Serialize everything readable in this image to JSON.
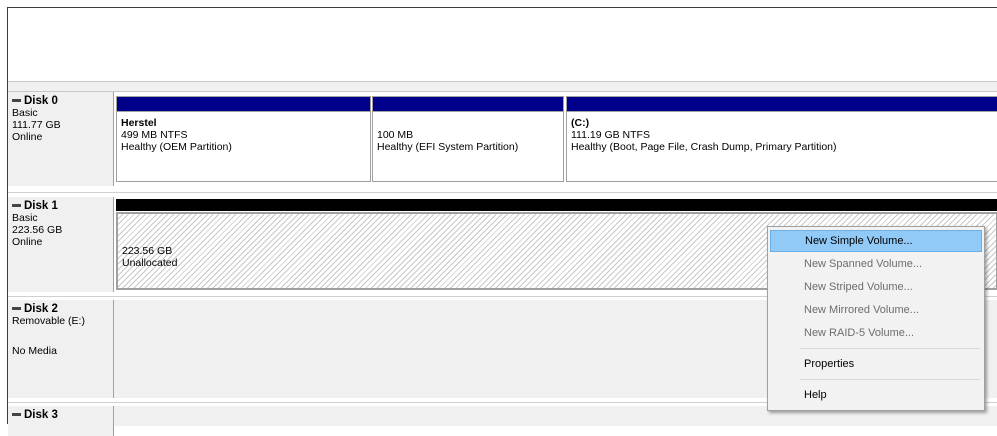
{
  "disks": [
    {
      "name": "Disk 0",
      "type": "Basic",
      "size": "111.77 GB",
      "status": "Online",
      "volumes": [
        {
          "title": "Herstel",
          "detail": "499 MB NTFS",
          "health": "Healthy (OEM Partition)"
        },
        {
          "title": "",
          "detail": "100 MB",
          "health": "Healthy (EFI System Partition)"
        },
        {
          "title": "(C:)",
          "detail": "111.19 GB NTFS",
          "health": "Healthy (Boot, Page File, Crash Dump, Primary Partition)"
        }
      ]
    },
    {
      "name": "Disk 1",
      "type": "Basic",
      "size": "223.56 GB",
      "status": "Online",
      "unallocated": {
        "size": "223.56 GB",
        "label": "Unallocated"
      }
    },
    {
      "name": "Disk 2",
      "type": "Removable (E:)",
      "status": "No Media"
    },
    {
      "name": "Disk 3"
    }
  ],
  "context_menu": {
    "items": [
      {
        "label": "New Simple Volume...",
        "enabled": true,
        "highlighted": true
      },
      {
        "label": "New Spanned Volume...",
        "enabled": false
      },
      {
        "label": "New Striped Volume...",
        "enabled": false
      },
      {
        "label": "New Mirrored Volume...",
        "enabled": false
      },
      {
        "label": "New RAID-5 Volume...",
        "enabled": false
      }
    ],
    "properties": "Properties",
    "help": "Help"
  },
  "colors": {
    "primary_partition_bar": "#00008b",
    "unallocated_bar": "#000000",
    "menu_highlight": "#91c9f7"
  }
}
